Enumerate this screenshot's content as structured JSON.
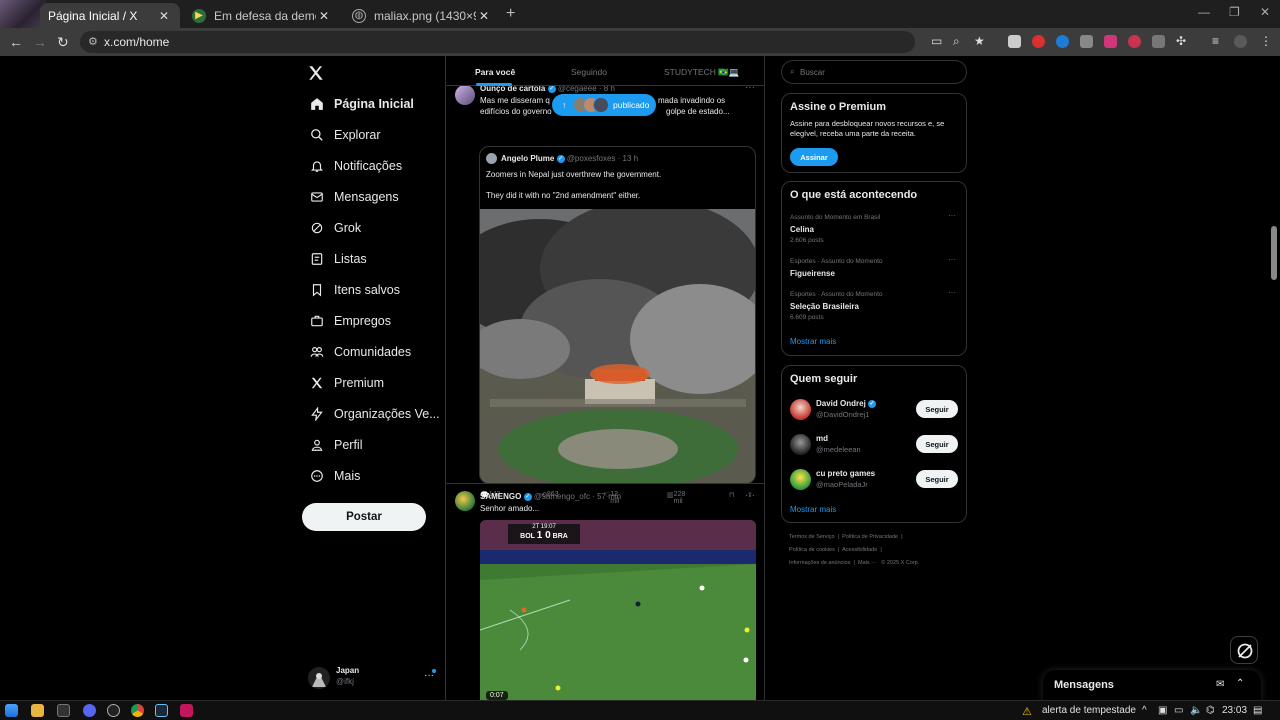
{
  "browser": {
    "tabs": [
      {
        "title": "Página Inicial / X",
        "close": "✕"
      },
      {
        "title": "Em defesa da democracia brasil",
        "close": "✕"
      },
      {
        "title": "maliax.png (1430×921)",
        "close": "✕"
      }
    ],
    "new_tab": "+",
    "url": "x.com/home"
  },
  "sidebar": {
    "items": [
      {
        "label": "Página Inicial"
      },
      {
        "label": "Explorar"
      },
      {
        "label": "Notificações"
      },
      {
        "label": "Mensagens"
      },
      {
        "label": "Grok"
      },
      {
        "label": "Listas"
      },
      {
        "label": "Itens salvos"
      },
      {
        "label": "Empregos"
      },
      {
        "label": "Comunidades"
      },
      {
        "label": "Premium"
      },
      {
        "label": "Organizações Ve..."
      },
      {
        "label": "Perfil"
      },
      {
        "label": "Mais"
      }
    ],
    "post_label": "Postar",
    "account": {
      "name": "Japan",
      "handle": "@ifkj",
      "more": "···"
    }
  },
  "timeline": {
    "tabs": [
      "Para você",
      "Seguindo",
      "STUDYTECH 🇧🇷💻"
    ],
    "pill_label": "publicado",
    "pill_arrow": "↑",
    "tweet1": {
      "name": "Ounço de cartola",
      "handle": "@cegaeee",
      "time": "· 8 h",
      "text_line1": "Mas me disseram q",
      "text_line1b": "mada invadindo os",
      "text_line2": "edifícios do governo",
      "text_line2b": "golpe de estado...",
      "more": "···",
      "quote": {
        "name": "Angelo Plume",
        "handle": "@poxesfoxes",
        "time": "· 13 h",
        "text1": "Zoomers in Nepal just overthrew the government.",
        "text2": "They did it with no \"2nd amendment\" either."
      },
      "replies": "142",
      "reposts": "863",
      "likes": "12 mil",
      "views": "228 mil"
    },
    "tweet2": {
      "name": "SAMENGO",
      "handle": "@samengo_ofc",
      "time": "· 57 min",
      "text": "Senhor amado...",
      "more": "···",
      "scoreboard": {
        "period": "2T 19:07",
        "home": "BOL",
        "score": "1 0",
        "away": "BRA"
      },
      "video_time": "0:07"
    }
  },
  "right": {
    "search_placeholder": "Buscar",
    "premium": {
      "title": "Assine o Premium",
      "text1": "Assine para desbloquear novos recursos e, se",
      "text2": "elegível, receba uma parte da receita.",
      "button": "Assinar"
    },
    "trends": {
      "title": "O que está acontecendo",
      "items": [
        {
          "context": "Assunto do Momento em Brasil",
          "name": "Celina",
          "count": "2.606 posts"
        },
        {
          "context": "Esportes · Assunto do Momento",
          "name": "Figueirense",
          "count": ""
        },
        {
          "context": "Esportes · Assunto do Momento",
          "name": "Seleção Brasileira",
          "count": "6.609 posts"
        }
      ],
      "show_more": "Mostrar mais",
      "more": "···"
    },
    "follow": {
      "title": "Quem seguir",
      "items": [
        {
          "name": "David Ondrej",
          "handle": "@DavidOndrej1",
          "button": "Seguir"
        },
        {
          "name": "md",
          "handle": "@medeleean",
          "button": "Seguir"
        },
        {
          "name": "cu preto games",
          "handle": "@maoPeladaJr",
          "button": "Seguir"
        }
      ],
      "show_more": "Mostrar mais"
    },
    "footer": {
      "l1": [
        "Termos de Serviço",
        "|",
        "Política de Privacidade",
        "|"
      ],
      "l2": [
        "Política de cookies",
        "|",
        "Acessibilidade",
        "|"
      ],
      "l3": [
        "Informações de anúncios",
        "|",
        "Mais ···",
        "© 2025 X Corp."
      ]
    }
  },
  "messages": {
    "title": "Mensagens"
  },
  "taskbar": {
    "weather": "alerta de tempestade",
    "time": "23:03"
  },
  "colors": {
    "accent": "#1d9bf0",
    "background": "#000000",
    "border": "#2f3336",
    "muted": "#71767b"
  }
}
